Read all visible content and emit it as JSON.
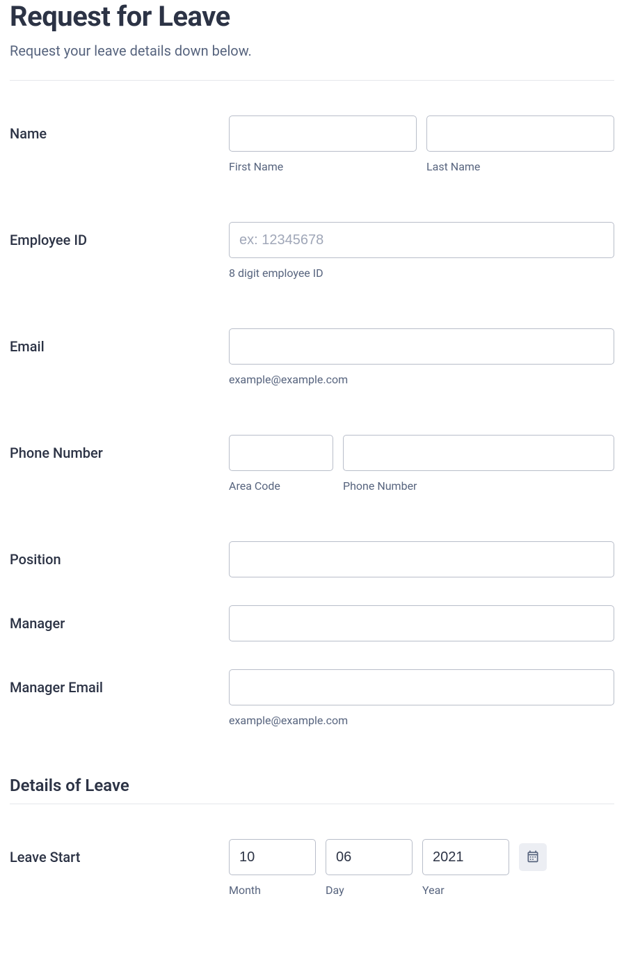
{
  "header": {
    "title": "Request for Leave",
    "subtitle": "Request your leave details down below."
  },
  "fields": {
    "name": {
      "label": "Name",
      "first_sublabel": "First Name",
      "last_sublabel": "Last Name",
      "first_value": "",
      "last_value": ""
    },
    "employee_id": {
      "label": "Employee ID",
      "placeholder": "ex: 12345678",
      "sublabel": "8 digit employee ID",
      "value": ""
    },
    "email": {
      "label": "Email",
      "sublabel": "example@example.com",
      "value": ""
    },
    "phone": {
      "label": "Phone Number",
      "area_sublabel": "Area Code",
      "number_sublabel": "Phone Number",
      "area_value": "",
      "number_value": ""
    },
    "position": {
      "label": "Position",
      "value": ""
    },
    "manager": {
      "label": "Manager",
      "value": ""
    },
    "manager_email": {
      "label": "Manager Email",
      "sublabel": "example@example.com",
      "value": ""
    }
  },
  "section": {
    "details_title": "Details of Leave"
  },
  "leave_start": {
    "label": "Leave Start",
    "month_value": "10",
    "month_sublabel": "Month",
    "day_value": "06",
    "day_sublabel": "Day",
    "year_value": "2021",
    "year_sublabel": "Year"
  }
}
